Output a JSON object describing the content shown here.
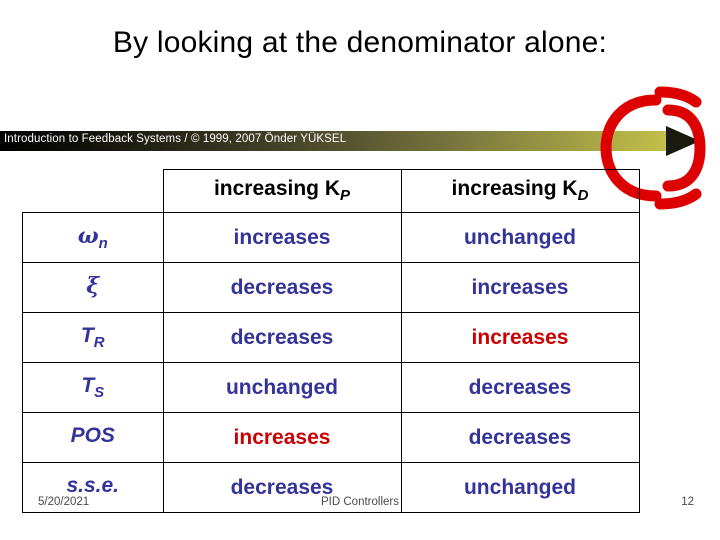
{
  "slide": {
    "title": "By looking at the denominator alone:",
    "banner_text": "Introduction to Feedback Systems / © 1999, 2007 Önder YÜKSEL",
    "footer": {
      "date": "5/20/2021",
      "center": "PID Controllers",
      "page": "12"
    }
  },
  "colors": {
    "blue": "#333399",
    "red": "#cc0000",
    "banner_start": "#000000",
    "banner_end": "#c3c04a",
    "spiral": "#dd0000"
  },
  "table": {
    "columns": [
      "",
      "increasing KP",
      "increasing KD"
    ],
    "column_parts": [
      {
        "text": "",
        "sub": ""
      },
      {
        "text": "increasing K",
        "sub": "P"
      },
      {
        "text": "increasing K",
        "sub": "D"
      }
    ],
    "rows": [
      {
        "label_main": "ω",
        "label_sub": "n",
        "kp": {
          "text": "increases",
          "color": "blue"
        },
        "kd": {
          "text": "unchanged",
          "color": "blue"
        }
      },
      {
        "label_main": "ξ",
        "label_sub": "",
        "kp": {
          "text": "decreases",
          "color": "blue"
        },
        "kd": {
          "text": "increases",
          "color": "blue"
        }
      },
      {
        "label_main": "T",
        "label_sub": "R",
        "kp": {
          "text": "decreases",
          "color": "blue"
        },
        "kd": {
          "text": "increases",
          "color": "red"
        }
      },
      {
        "label_main": "T",
        "label_sub": "S",
        "kp": {
          "text": "unchanged",
          "color": "blue"
        },
        "kd": {
          "text": "decreases",
          "color": "blue"
        }
      },
      {
        "label_main": "POS",
        "label_sub": "",
        "kp": {
          "text": "increases",
          "color": "red"
        },
        "kd": {
          "text": "decreases",
          "color": "blue"
        }
      },
      {
        "label_main": "s.s.e.",
        "label_sub": "",
        "kp": {
          "text": "decreases",
          "color": "blue"
        },
        "kd": {
          "text": "unchanged",
          "color": "blue"
        }
      }
    ]
  }
}
